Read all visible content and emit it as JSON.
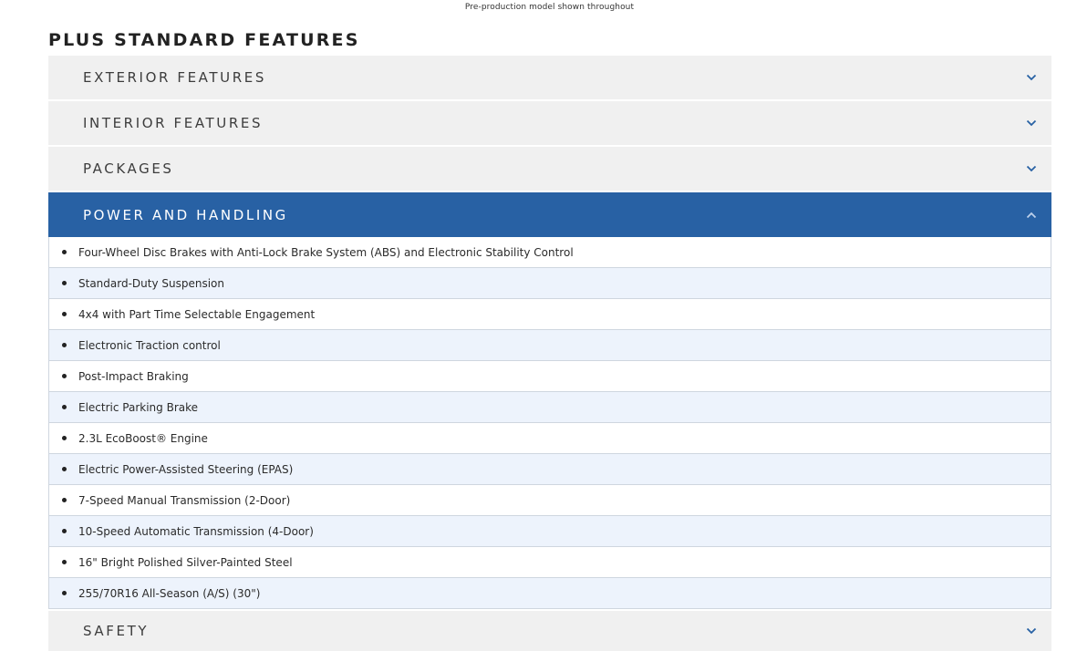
{
  "caption": "Pre-production model shown throughout",
  "section_title": "PLUS STANDARD FEATURES",
  "accordion": {
    "exterior": {
      "label": "EXTERIOR FEATURES",
      "icon": "chevron-down-icon"
    },
    "interior": {
      "label": "INTERIOR FEATURES",
      "icon": "chevron-down-icon"
    },
    "packages": {
      "label": "PACKAGES",
      "icon": "chevron-down-icon"
    },
    "power": {
      "label": "POWER AND HANDLING",
      "icon": "chevron-up-icon"
    },
    "safety": {
      "label": "SAFETY",
      "icon": "chevron-down-icon"
    }
  },
  "power_items": [
    "Four-Wheel Disc Brakes with Anti-Lock Brake System (ABS) and Electronic Stability Control",
    "Standard-Duty Suspension",
    "4x4 with Part Time Selectable Engagement",
    "Electronic Traction control",
    "Post-Impact Braking",
    "Electric Parking Brake",
    "2.3L EcoBoost® Engine",
    "Electric Power-Assisted Steering (EPAS)",
    "7-Speed Manual Transmission (2-Door)",
    "10-Speed Automatic Transmission (4-Door)",
    "16\" Bright Polished Silver-Painted Steel",
    "255/70R16 All-Season (A/S) (30\")"
  ],
  "colors": {
    "header_bg": "#f0f0f0",
    "active_bg": "#2861a4",
    "chevron": "#2861a4",
    "row_alt": "#edf3fc"
  }
}
